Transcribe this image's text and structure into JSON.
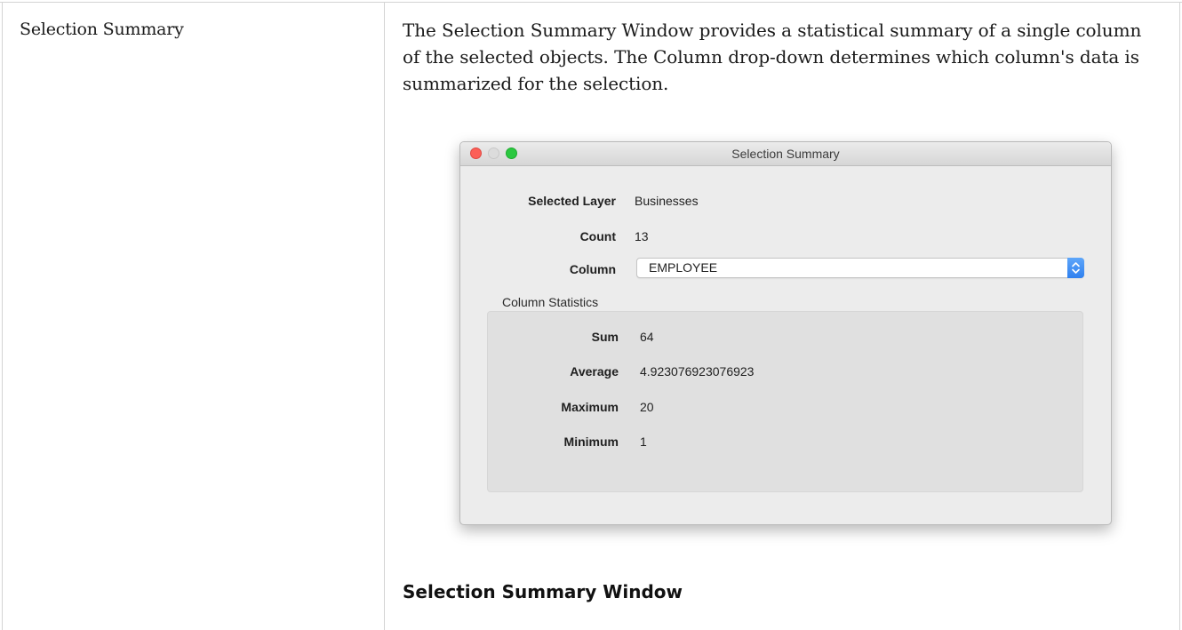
{
  "row": {
    "term": "Selection Summary",
    "description": "The Selection Summary Window provides a statistical summary of a single column of the selected objects.  The Column drop-down determines which column's data is summarized for the selection."
  },
  "window": {
    "title": "Selection Summary",
    "fields": {
      "selected_layer_label": "Selected Layer",
      "selected_layer_value": "Businesses",
      "count_label": "Count",
      "count_value": "13",
      "column_label": "Column",
      "column_value": "EMPLOYEE"
    },
    "statistics": {
      "group_label": "Column Statistics",
      "sum_label": "Sum",
      "sum_value": "64",
      "average_label": "Average",
      "average_value": "4.923076923076923",
      "maximum_label": "Maximum",
      "maximum_value": "20",
      "minimum_label": "Minimum",
      "minimum_value": "1"
    }
  },
  "caption": "Selection Summary Window",
  "colors": {
    "close": "#fc5f57",
    "minimize": "#dcdcdc",
    "zoom": "#2bc840",
    "select_accent": "#2f80ef"
  },
  "icons": {
    "dropdown": "updown-chevron-icon"
  }
}
